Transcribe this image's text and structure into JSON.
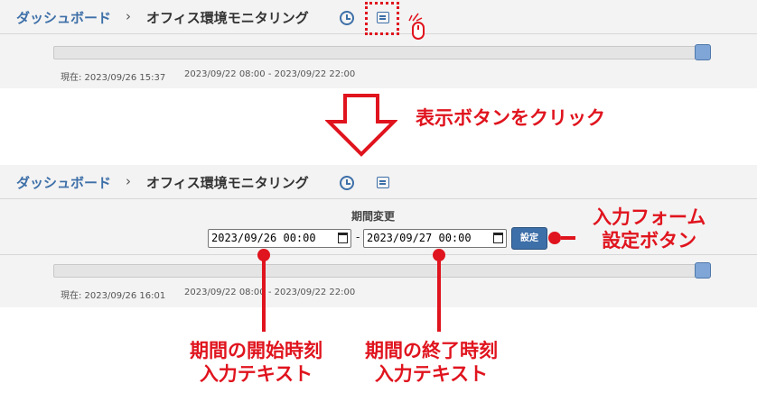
{
  "breadcrumb": {
    "parent": "ダッシュボード",
    "separator": "›",
    "current": "オフィス環境モニタリング"
  },
  "top_panel": {
    "now_label": "現在: 2023/09/26 15:37",
    "range_label": "2023/09/22 08:00 - 2023/09/22 22:00"
  },
  "step_caption": "表示ボタンをクリック",
  "bottom_panel": {
    "period_title": "期間変更",
    "start_value": "2023/09/26 00:00",
    "range_separator": "-",
    "end_value": "2023/09/27 00:00",
    "set_button_label": "設定",
    "now_label": "現在: 2023/09/26 16:01",
    "range_label": "2023/09/22 08:00 - 2023/09/22 22:00"
  },
  "annotations": {
    "set_button_line1": "入力フォーム",
    "set_button_line2": "設定ボタン",
    "start_line1": "期間の開始時刻",
    "start_line2": "入力テキスト",
    "end_line1": "期間の終了時刻",
    "end_line2": "入力テキスト"
  },
  "slider": {
    "position_fraction": 1.0
  },
  "colors": {
    "accent": "#3d6fa8",
    "annotation_red": "#e0141e",
    "panel_bg": "#f3f3f3"
  },
  "icons": {
    "history": "clock-icon",
    "display": "display-icon",
    "pointer": "mouse-icon",
    "calendar": "calendar-icon"
  }
}
